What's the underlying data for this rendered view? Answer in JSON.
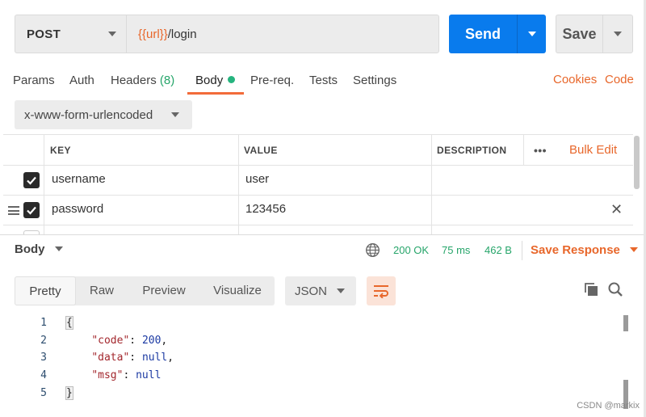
{
  "request": {
    "method": "POST",
    "url_variable": "{{url}}",
    "url_path": "/login",
    "send_label": "Send",
    "save_label": "Save"
  },
  "tabs": [
    {
      "label": "Params"
    },
    {
      "label": "Auth"
    },
    {
      "label": "Headers",
      "count": "(8)"
    },
    {
      "label": "Body",
      "active": true,
      "indicator": "green-dot"
    },
    {
      "label": "Pre-req."
    },
    {
      "label": "Tests"
    },
    {
      "label": "Settings"
    }
  ],
  "links": {
    "cookies": "Cookies",
    "code": "Code"
  },
  "body_type": "x-www-form-urlencoded",
  "params_table": {
    "headers": {
      "key": "KEY",
      "value": "VALUE",
      "description": "DESCRIPTION",
      "more": "•••",
      "bulk_edit": "Bulk Edit"
    },
    "rows": [
      {
        "checked": true,
        "key": "username",
        "value": "user",
        "description": ""
      },
      {
        "checked": true,
        "key": "password",
        "value": "123456",
        "description": ""
      }
    ]
  },
  "response": {
    "body_label": "Body",
    "status": "200 OK",
    "time": "75 ms",
    "size": "462 B",
    "save_response": "Save Response",
    "views": [
      "Pretty",
      "Raw",
      "Preview",
      "Visualize"
    ],
    "active_view": "Pretty",
    "format": "JSON",
    "lines": [
      {
        "n": "1",
        "text": "{"
      },
      {
        "n": "2",
        "text": "    \"code\": 200,"
      },
      {
        "n": "3",
        "text": "    \"data\": null,"
      },
      {
        "n": "4",
        "text": "    \"msg\": null"
      },
      {
        "n": "5",
        "text": "}"
      }
    ]
  },
  "watermark": "CSDN @markix",
  "colors": {
    "accent_orange": "#e8672b",
    "send_blue": "#097bed",
    "success_green": "#26a56a"
  }
}
